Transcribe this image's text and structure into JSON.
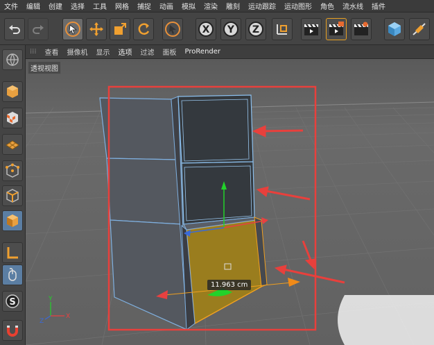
{
  "menu": [
    "文件",
    "编辑",
    "创建",
    "选择",
    "工具",
    "网格",
    "捕捉",
    "动画",
    "模拟",
    "渲染",
    "雕刻",
    "运动跟踪",
    "运动图形",
    "角色",
    "流水线",
    "插件"
  ],
  "viewport_menu": {
    "grip": "⁞⁞⁞",
    "items": [
      "查看",
      "摄像机",
      "显示",
      "选项",
      "过滤",
      "面板"
    ],
    "active_item": "选项",
    "prorender": "ProRender"
  },
  "viewport": {
    "label": "透视视图",
    "measure": "11.963 cm",
    "axis_x": "X",
    "axis_y": "Y",
    "axis_z": "Z"
  },
  "toolbar": {
    "x_label": "X",
    "y_label": "Y",
    "z_label": "Z"
  },
  "colors": {
    "highlight_box": "#e8403c",
    "selected_face": "#9a7d1e",
    "y_axis": "#22d22a",
    "x_axis": "#e84040",
    "z_axis": "#3a6ad8",
    "measure_arrow": "#f08a18",
    "active_tool": "#5b7ea3"
  }
}
